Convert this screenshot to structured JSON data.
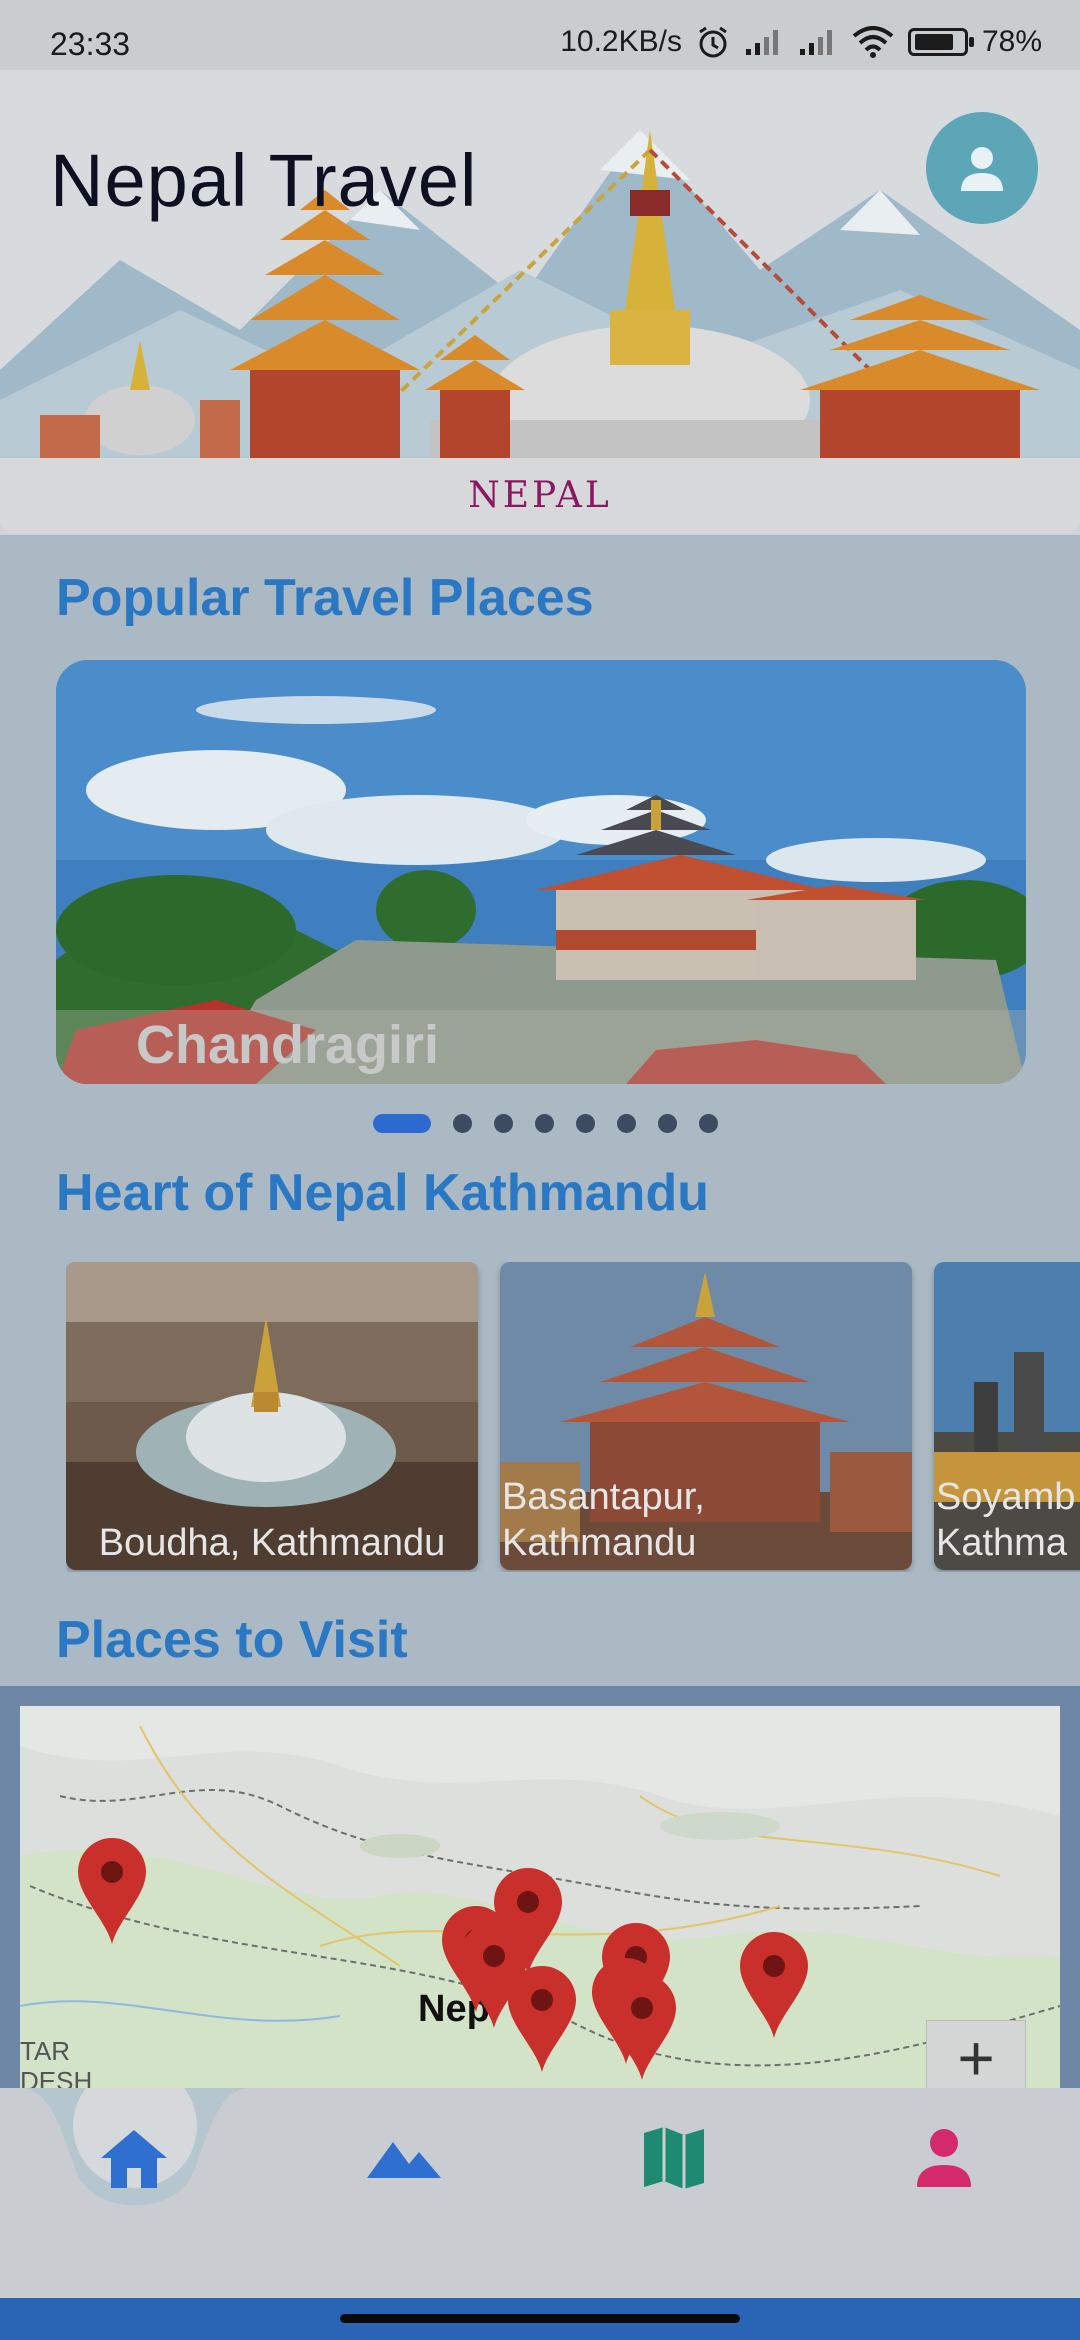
{
  "status_bar": {
    "time": "23:33",
    "net_speed": "10.2KB/s",
    "battery": "78%"
  },
  "header": {
    "title": "Nepal Travel",
    "banner_label": "NEPAL",
    "profile_icon": "person-icon"
  },
  "popular": {
    "title": "Popular Travel Places",
    "current_caption": "Chandragiri",
    "slide_count": 8,
    "active_index": 0
  },
  "kathmandu": {
    "title": "Heart of Nepal Kathmandu",
    "cards": [
      {
        "label": "Boudha, Kathmandu"
      },
      {
        "label": "Basantapur,\nKathmandu"
      },
      {
        "label": "Soyamb\nKathma"
      }
    ]
  },
  "places": {
    "title": "Places to Visit",
    "map_label": "Nep",
    "map_edge_label_1": "TAR",
    "map_edge_label_2": "DESH",
    "zoom_in_label": "+"
  },
  "nav": {
    "items": [
      {
        "name": "home",
        "icon": "home-icon",
        "color": "#2f6fd0"
      },
      {
        "name": "places",
        "icon": "mountain-icon",
        "color": "#2f6fd0"
      },
      {
        "name": "map",
        "icon": "map-icon",
        "color": "#1f8a72"
      },
      {
        "name": "profile",
        "icon": "person-icon",
        "color": "#d42a6c"
      }
    ]
  },
  "colors": {
    "accent": "#2a78c4",
    "nepal_label": "#8b1763"
  }
}
